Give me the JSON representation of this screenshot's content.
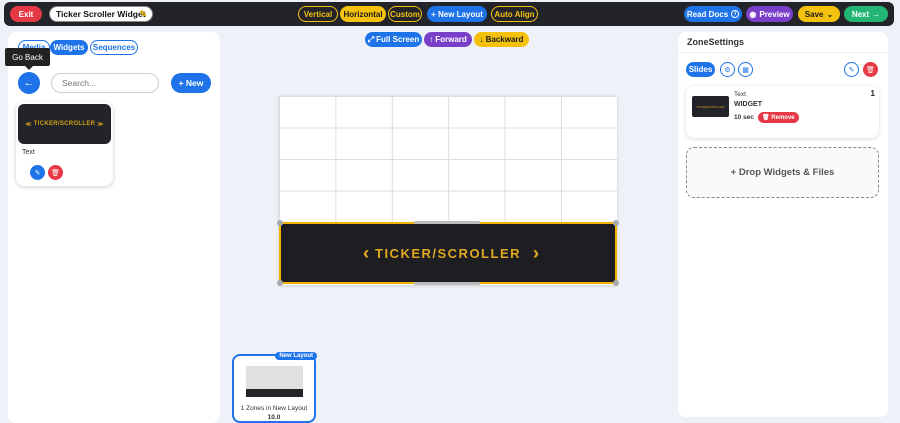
{
  "topbar": {
    "exit_label": "Exit",
    "widget_title": "Ticker Scroller Widget",
    "layout_buttons": [
      "Vertical",
      "Horizontal",
      "Custom"
    ],
    "new_layout_label": "+ New Layout",
    "auto_align_label": "Auto Align",
    "read_docs_label": "Read Docs",
    "preview_label": "Preview",
    "save_label": "Save",
    "next_label": "Next"
  },
  "left": {
    "tabs": [
      "Media",
      "Widgets",
      "Sequences"
    ],
    "active_tab": "Widgets",
    "tooltip": "Go Back",
    "search_placeholder": "Search...",
    "new_label": "+ New",
    "widget": {
      "thumb_text": "TICKER/SCROLLER",
      "name": "Text"
    }
  },
  "center": {
    "fullscreen_label": "Full Screen",
    "forward_label": "Forward",
    "backward_label": "Backward",
    "ticker_text": "TICKER/SCROLLER",
    "layout_card": {
      "badge": "New Layout",
      "caption": "1 Zones in New Layout",
      "value": "10.0"
    }
  },
  "right": {
    "title": "ZoneSettings",
    "slides_label": "Slides",
    "slide": {
      "name": "Text",
      "type": "WIDGET",
      "duration": "10 sec",
      "remove_label": "Remove",
      "index": "1"
    },
    "drop_label": "+ Drop Widgets & Files"
  },
  "colors": {
    "primary": "#1e73e8",
    "danger": "#e53945",
    "warning": "#f4c20d",
    "purple": "#7a3fc9",
    "success": "#22b573",
    "dark": "#23242a"
  }
}
